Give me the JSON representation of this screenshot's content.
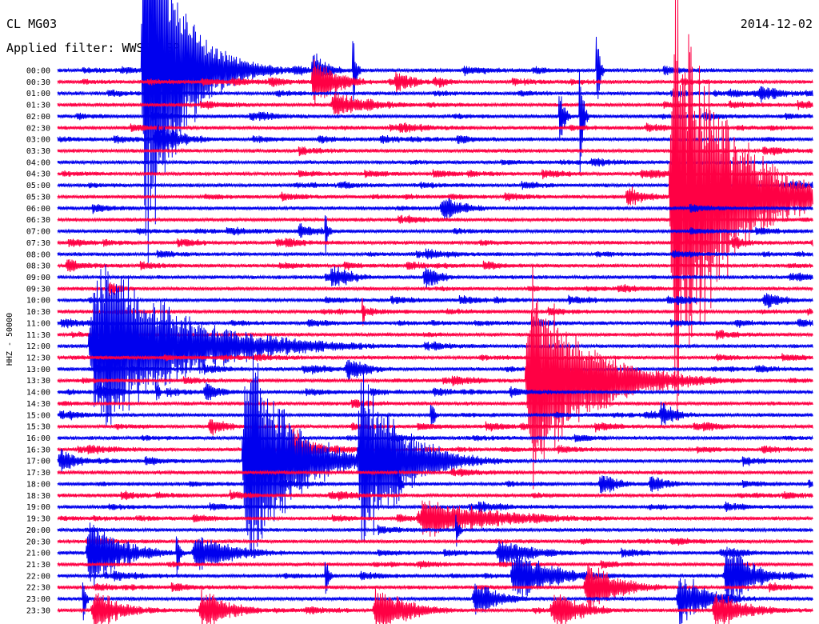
{
  "header": {
    "station": "CL MG03",
    "date": "2014-12-02",
    "filter": "Applied filter: WWSSN-SP"
  },
  "chart_data": {
    "type": "helicorder",
    "ylabel": "HHZ - 50000",
    "line_colors": [
      "#0000ee",
      "#ff0044"
    ],
    "time_labels": [
      "00:00",
      "00:30",
      "01:00",
      "01:30",
      "02:00",
      "02:30",
      "03:00",
      "03:30",
      "04:00",
      "04:30",
      "05:00",
      "05:30",
      "06:00",
      "06:30",
      "07:00",
      "07:30",
      "08:00",
      "08:30",
      "09:00",
      "09:30",
      "10:00",
      "10:30",
      "11:00",
      "11:30",
      "12:00",
      "12:30",
      "13:00",
      "13:30",
      "14:00",
      "14:30",
      "15:00",
      "15:30",
      "16:00",
      "16:30",
      "17:00",
      "17:30",
      "18:00",
      "18:30",
      "19:00",
      "19:30",
      "20:00",
      "20:30",
      "21:00",
      "21:30",
      "22:00",
      "22:30",
      "23:00",
      "23:30"
    ],
    "events": [
      {
        "row": 0,
        "minute": 3.3,
        "amp": 300,
        "dur": 2.2
      },
      {
        "row": 1,
        "minute": 10.1,
        "amp": 40,
        "dur": 1.5
      },
      {
        "row": 1,
        "minute": 13.4,
        "amp": 18,
        "dur": 1.2
      },
      {
        "row": 0,
        "minute": 10.1,
        "amp": 30,
        "dur": 1.0
      },
      {
        "row": 2,
        "minute": 27.8,
        "amp": 14,
        "dur": 2.0
      },
      {
        "row": 3,
        "minute": 10.8,
        "amp": 18,
        "dur": 2.8
      },
      {
        "row": 1,
        "minute": 14.9,
        "amp": 10,
        "dur": 1.2
      },
      {
        "row": 4,
        "minute": 19.9,
        "amp": 60,
        "dur": 0.3
      },
      {
        "row": 6,
        "minute": 3.8,
        "amp": 24,
        "dur": 1.8
      },
      {
        "row": 11,
        "minute": 24.3,
        "amp": 320,
        "dur": 3.2
      },
      {
        "row": 11,
        "minute": 22.6,
        "amp": 20,
        "dur": 1.0
      },
      {
        "row": 12,
        "minute": 15.2,
        "amp": 22,
        "dur": 1.4
      },
      {
        "row": 14,
        "minute": 9.5,
        "amp": 12,
        "dur": 1.6
      },
      {
        "row": 15,
        "minute": 26.8,
        "amp": 14,
        "dur": 0.8
      },
      {
        "row": 17,
        "minute": 0.3,
        "amp": 12,
        "dur": 1.0
      },
      {
        "row": 18,
        "minute": 10.8,
        "amp": 20,
        "dur": 1.4
      },
      {
        "row": 18,
        "minute": 14.5,
        "amp": 18,
        "dur": 1.2
      },
      {
        "row": 19,
        "minute": 2.0,
        "amp": 12,
        "dur": 1.2
      },
      {
        "row": 20,
        "minute": 28.0,
        "amp": 14,
        "dur": 1.4
      },
      {
        "row": 24,
        "minute": 1.2,
        "amp": 140,
        "dur": 5.0
      },
      {
        "row": 26,
        "minute": 11.4,
        "amp": 18,
        "dur": 1.5
      },
      {
        "row": 27,
        "minute": 18.6,
        "amp": 160,
        "dur": 3.5
      },
      {
        "row": 28,
        "minute": 1.5,
        "amp": 14,
        "dur": 1.5
      },
      {
        "row": 28,
        "minute": 5.8,
        "amp": 20,
        "dur": 1.0
      },
      {
        "row": 30,
        "minute": 23.9,
        "amp": 18,
        "dur": 1.2
      },
      {
        "row": 31,
        "minute": 6.0,
        "amp": 16,
        "dur": 1.2
      },
      {
        "row": 33,
        "minute": 9.2,
        "amp": 40,
        "dur": 1.2
      },
      {
        "row": 34,
        "minute": 7.3,
        "amp": 200,
        "dur": 2.5
      },
      {
        "row": 34,
        "minute": 11.9,
        "amp": 140,
        "dur": 2.5
      },
      {
        "row": 34,
        "minute": 0.0,
        "amp": 20,
        "dur": 1.2
      },
      {
        "row": 36,
        "minute": 21.5,
        "amp": 20,
        "dur": 1.2
      },
      {
        "row": 36,
        "minute": 23.5,
        "amp": 16,
        "dur": 1.2
      },
      {
        "row": 39,
        "minute": 14.2,
        "amp": 30,
        "dur": 5.0
      },
      {
        "row": 42,
        "minute": 1.1,
        "amp": 60,
        "dur": 2.0
      },
      {
        "row": 42,
        "minute": 5.3,
        "amp": 30,
        "dur": 2.5
      },
      {
        "row": 42,
        "minute": 17.4,
        "amp": 20,
        "dur": 2.5
      },
      {
        "row": 44,
        "minute": 18.0,
        "amp": 40,
        "dur": 2.5
      },
      {
        "row": 44,
        "minute": 26.5,
        "amp": 60,
        "dur": 1.5
      },
      {
        "row": 45,
        "minute": 20.9,
        "amp": 40,
        "dur": 2.0
      },
      {
        "row": 46,
        "minute": 16.5,
        "amp": 30,
        "dur": 1.5
      },
      {
        "row": 46,
        "minute": 24.6,
        "amp": 40,
        "dur": 2.0
      },
      {
        "row": 47,
        "minute": 1.3,
        "amp": 30,
        "dur": 2.0
      },
      {
        "row": 47,
        "minute": 5.6,
        "amp": 30,
        "dur": 2.0
      },
      {
        "row": 47,
        "minute": 12.5,
        "amp": 40,
        "dur": 2.0
      },
      {
        "row": 47,
        "minute": 19.6,
        "amp": 30,
        "dur": 2.0
      },
      {
        "row": 47,
        "minute": 26.0,
        "amp": 30,
        "dur": 2.0
      }
    ],
    "spikes": [
      {
        "row": 0,
        "minute": 11.7,
        "amp": 90
      },
      {
        "row": 0,
        "minute": 21.4,
        "amp": 90
      },
      {
        "row": 4,
        "minute": 20.7,
        "amp": 130
      },
      {
        "row": 14,
        "minute": 10.6,
        "amp": 40
      },
      {
        "row": 21,
        "minute": 12.1,
        "amp": 30
      },
      {
        "row": 24,
        "minute": 4.8,
        "amp": 30
      },
      {
        "row": 28,
        "minute": 3.9,
        "amp": 30
      },
      {
        "row": 30,
        "minute": 14.8,
        "amp": 40
      },
      {
        "row": 36,
        "minute": 13.5,
        "amp": 40
      },
      {
        "row": 40,
        "minute": 15.8,
        "amp": 40
      },
      {
        "row": 42,
        "minute": 4.7,
        "amp": 60
      },
      {
        "row": 44,
        "minute": 10.6,
        "amp": 60
      },
      {
        "row": 46,
        "minute": 1.0,
        "amp": 40
      }
    ]
  }
}
